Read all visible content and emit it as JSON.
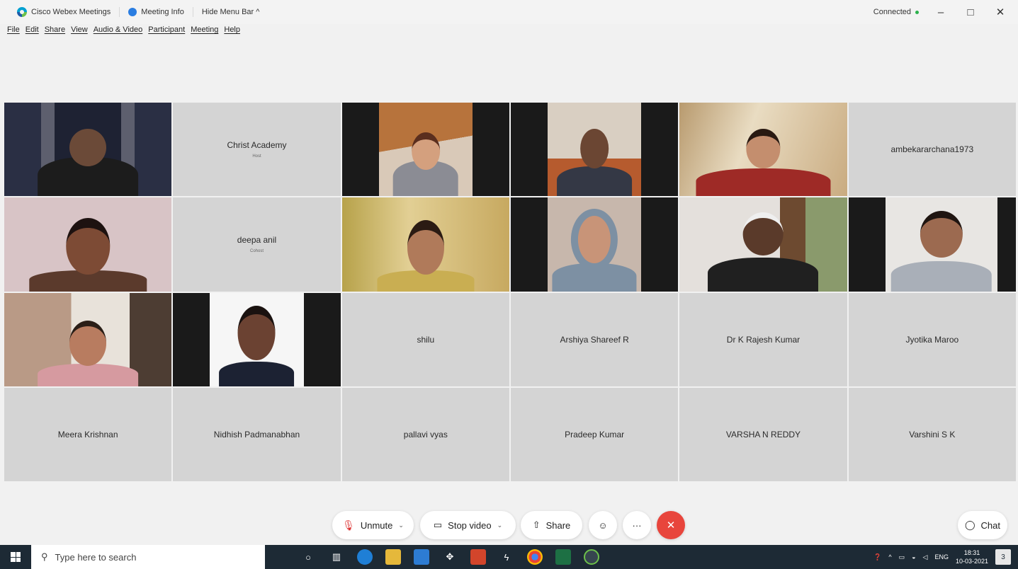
{
  "titlebar": {
    "app_name": "Cisco Webex Meetings",
    "meeting_info": "Meeting Info",
    "hide_menu": "Hide Menu Bar ^",
    "status": "Connected",
    "minimize": "–",
    "restore": "□",
    "close": "✕"
  },
  "menu": [
    "File",
    "Edit",
    "Share",
    "View",
    "Audio & Video",
    "Participant",
    "Meeting",
    "Help"
  ],
  "participants": [
    {
      "name": "",
      "role": "",
      "video": true
    },
    {
      "name": "Christ Academy",
      "role": "Host",
      "video": false
    },
    {
      "name": "",
      "role": "",
      "video": true
    },
    {
      "name": "",
      "role": "",
      "video": true
    },
    {
      "name": "",
      "role": "",
      "video": true
    },
    {
      "name": "ambekararchana1973",
      "role": "",
      "video": false
    },
    {
      "name": "",
      "role": "",
      "video": true
    },
    {
      "name": "deepa anil",
      "role": "Cohost",
      "video": false
    },
    {
      "name": "",
      "role": "",
      "video": true
    },
    {
      "name": "",
      "role": "",
      "video": true
    },
    {
      "name": "",
      "role": "",
      "video": true
    },
    {
      "name": "",
      "role": "",
      "video": true
    },
    {
      "name": "",
      "role": "",
      "video": true
    },
    {
      "name": "",
      "role": "",
      "video": true
    },
    {
      "name": "shilu",
      "role": "",
      "video": false
    },
    {
      "name": "Arshiya Shareef R",
      "role": "",
      "video": false
    },
    {
      "name": "Dr K Rajesh Kumar",
      "role": "",
      "video": false
    },
    {
      "name": "Jyotika Maroo",
      "role": "",
      "video": false
    },
    {
      "name": "Meera Krishnan",
      "role": "",
      "video": false
    },
    {
      "name": "Nidhish Padmanabhan",
      "role": "",
      "video": false
    },
    {
      "name": "pallavi vyas",
      "role": "",
      "video": false
    },
    {
      "name": "Pradeep Kumar",
      "role": "",
      "video": false
    },
    {
      "name": "VARSHA N REDDY",
      "role": "",
      "video": false
    },
    {
      "name": "Varshini S K",
      "role": "",
      "video": false
    }
  ],
  "controls": {
    "unmute": "Unmute",
    "stop_video": "Stop video",
    "share": "Share",
    "reactions_icon": "☺",
    "more_icon": "···",
    "leave_icon": "✕",
    "chat": "Chat"
  },
  "taskbar": {
    "search_placeholder": "Type here to search",
    "lang": "ENG",
    "time": "18:31",
    "date": "10-03-2021",
    "notifications": "3"
  }
}
